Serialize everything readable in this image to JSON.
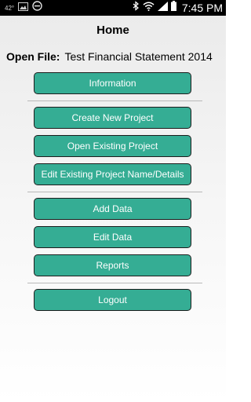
{
  "status_bar": {
    "temperature": "42°",
    "time": "7:45 PM",
    "icons": [
      "image-icon",
      "do-not-disturb-icon",
      "bluetooth-icon",
      "wifi-icon",
      "signal-icon",
      "battery-icon"
    ]
  },
  "header": {
    "title": "Home"
  },
  "file": {
    "label": "Open File:",
    "name": "Test Financial Statement 2014"
  },
  "menu": {
    "information": "Information",
    "create_new_project": "Create New Project",
    "open_existing_project": "Open Existing Project",
    "edit_existing_project": "Edit Existing Project Name/Details",
    "add_data": "Add Data",
    "edit_data": "Edit Data",
    "reports": "Reports",
    "logout": "Logout"
  },
  "colors": {
    "button": "#35ad94",
    "button_border": "#1d1d1d",
    "divider": "#b9b9b9"
  }
}
